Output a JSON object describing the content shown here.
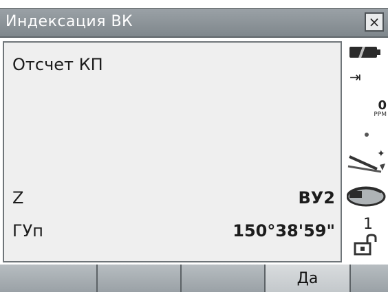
{
  "window": {
    "title": "Индексация ВК",
    "close_label": "×"
  },
  "main": {
    "heading": "Отсчет КП",
    "rows": [
      {
        "label": "Z",
        "value": "ВУ2"
      },
      {
        "label": "ГУп",
        "value": "150°38'59\""
      }
    ]
  },
  "status_column": {
    "icons": [
      "battery-icon",
      "target-icon",
      "ppm-icon",
      "dot-icon",
      "prism-icon",
      "laser-icon",
      "one-indicator",
      "lock-icon"
    ],
    "ppm_value": "0",
    "ppm_unit": "PPM",
    "face_indicator": "1"
  },
  "softkeys": [
    "",
    "",
    "",
    "Да",
    ""
  ]
}
